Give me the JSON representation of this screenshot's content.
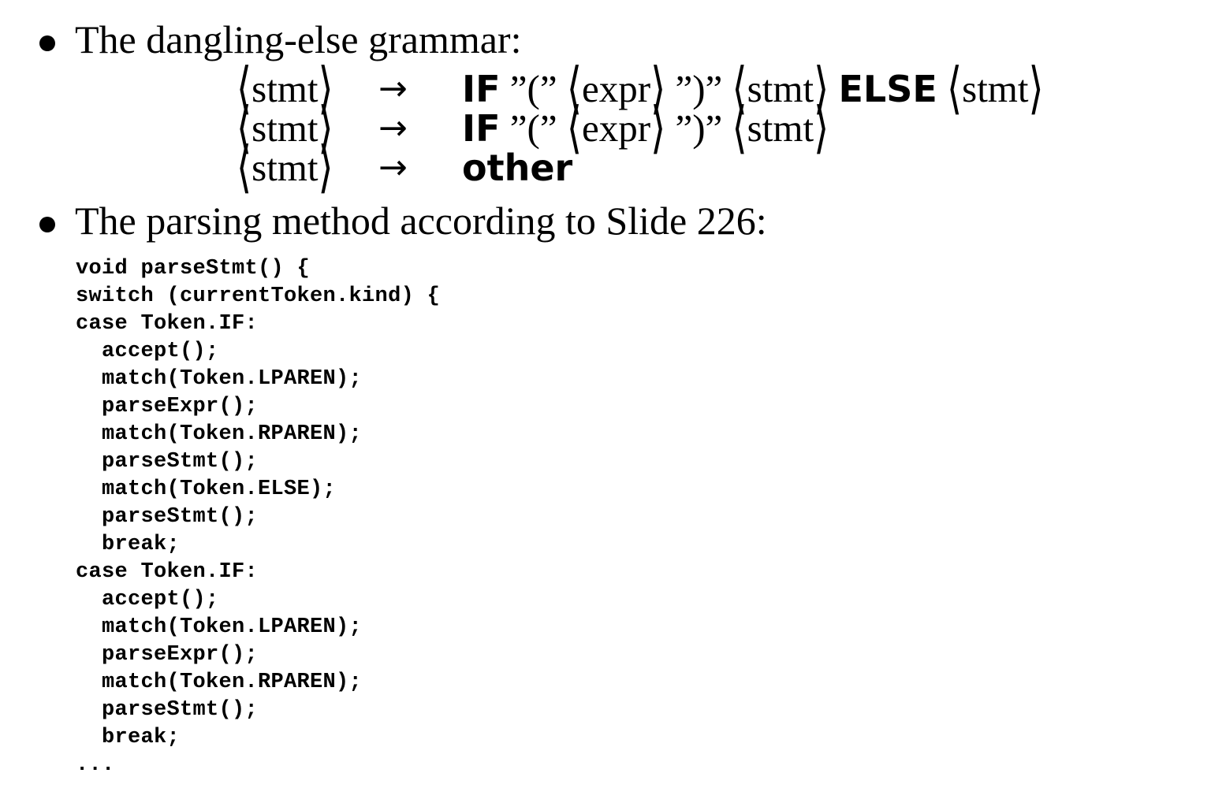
{
  "bullets": [
    "The dangling-else grammar:",
    "The parsing method according to Slide 226:"
  ],
  "grammar": {
    "stmt": "stmt",
    "expr": "expr",
    "arrow": "→",
    "if_kw": "IF",
    "else_kw": "ELSE",
    "other_kw": "other",
    "lparen": "”(”",
    "rparen": "”)”"
  },
  "code_lines": [
    "void parseStmt() {",
    "switch (currentToken.kind) {",
    "case Token.IF:",
    "  accept();",
    "  match(Token.LPAREN);",
    "  parseExpr();",
    "  match(Token.RPAREN);",
    "  parseStmt();",
    "  match(Token.ELSE);",
    "  parseStmt();",
    "  break;",
    "case Token.IF:",
    "  accept();",
    "  match(Token.LPAREN);",
    "  parseExpr();",
    "  match(Token.RPAREN);",
    "  parseStmt();",
    "  break;",
    "..."
  ]
}
